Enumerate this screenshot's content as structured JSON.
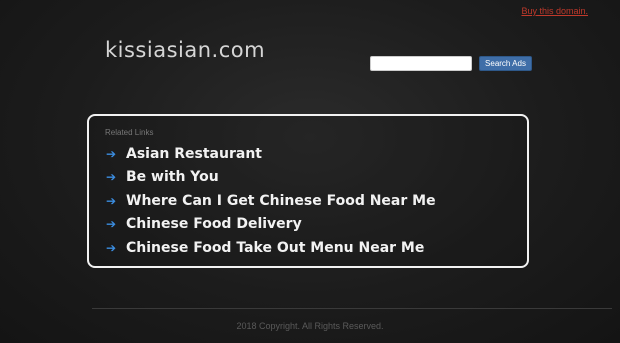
{
  "header": {
    "buy_link": "Buy this domain.",
    "site_title": "kissiasian.com"
  },
  "search": {
    "placeholder": "",
    "value": "",
    "button_label": "Search Ads"
  },
  "related": {
    "heading": "Related Links",
    "items": [
      {
        "label": "Asian Restaurant",
        "icon": "arrow-right-icon"
      },
      {
        "label": "Be with You",
        "icon": "arrow-right-icon"
      },
      {
        "label": "Where Can I Get Chinese Food Near Me",
        "icon": "arrow-right-icon"
      },
      {
        "label": "Chinese Food Delivery",
        "icon": "arrow-right-icon"
      },
      {
        "label": "Chinese Food Take Out Menu Near Me",
        "icon": "arrow-right-icon"
      }
    ]
  },
  "footer": {
    "copyright": "2018 Copyright. All Rights Reserved."
  },
  "colors": {
    "background": "#1c1c1c",
    "link_accent": "#3b8de0",
    "buy_link": "#c0392b",
    "button": "#3f6ea8"
  }
}
